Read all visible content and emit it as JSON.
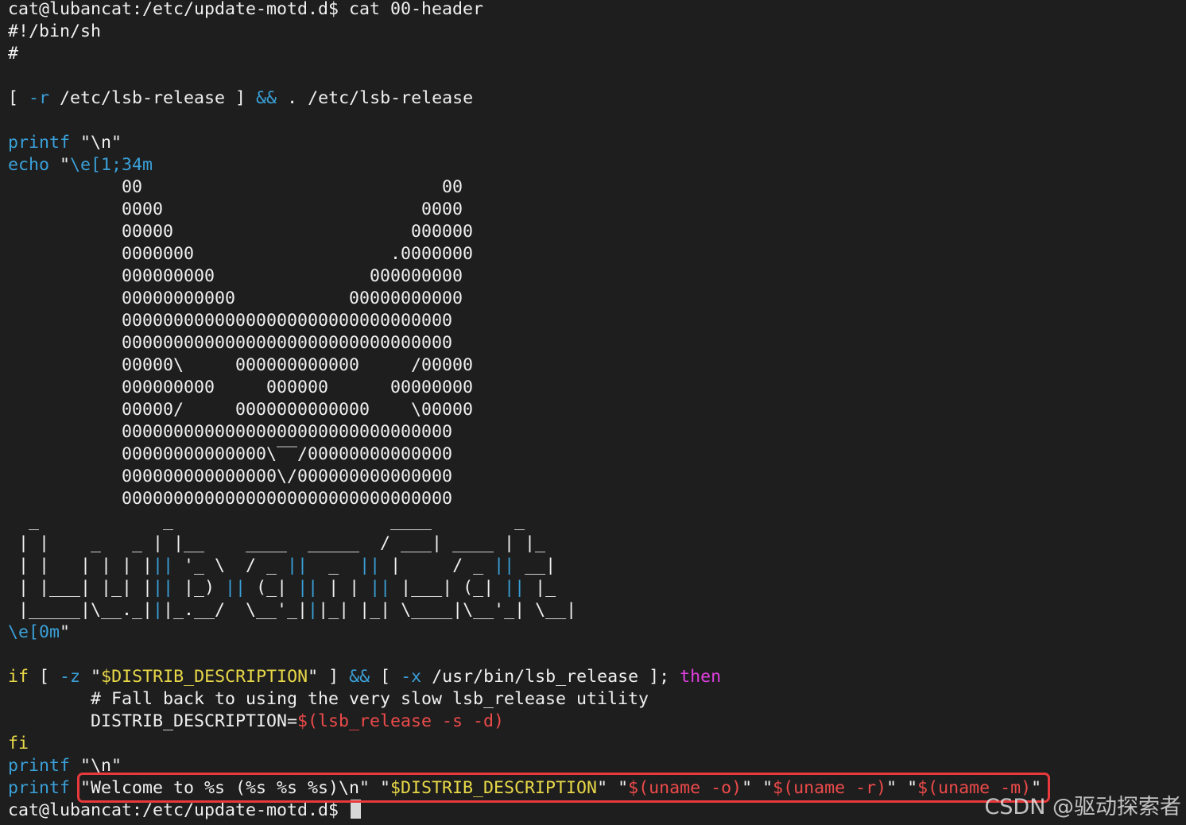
{
  "terminal": {
    "lines": [
      [
        {
          "t": "cat@lubancat:/etc/update-motd.d$ cat 00-header",
          "c": "white"
        }
      ],
      [
        {
          "t": "#!/bin/sh",
          "c": "white"
        }
      ],
      [
        {
          "t": "#",
          "c": "white"
        }
      ],
      [],
      [
        {
          "t": "[ ",
          "c": "white"
        },
        {
          "t": "-r",
          "c": "cyan"
        },
        {
          "t": " /etc/lsb-release ] ",
          "c": "white"
        },
        {
          "t": "&&",
          "c": "cyan"
        },
        {
          "t": " . /etc/lsb-release",
          "c": "white"
        }
      ],
      [],
      [
        {
          "t": "printf",
          "c": "cyan"
        },
        {
          "t": " \"\\n\"",
          "c": "white"
        }
      ],
      [
        {
          "t": "echo",
          "c": "cyan"
        },
        {
          "t": " \"",
          "c": "white"
        },
        {
          "t": "\\e[1;34m",
          "c": "cyan"
        }
      ],
      [
        {
          "t": "           00                             00",
          "c": "white"
        }
      ],
      [
        {
          "t": "           0000                         0000",
          "c": "white"
        }
      ],
      [
        {
          "t": "           00000                       000000",
          "c": "white"
        }
      ],
      [
        {
          "t": "           0000000                   .0000000",
          "c": "white"
        }
      ],
      [
        {
          "t": "           000000000               000000000",
          "c": "white"
        }
      ],
      [
        {
          "t": "           00000000000           00000000000",
          "c": "white"
        }
      ],
      [
        {
          "t": "           00000000000000000000000000000000",
          "c": "white"
        }
      ],
      [
        {
          "t": "           00000000000000000000000000000000",
          "c": "white"
        }
      ],
      [
        {
          "t": "           00000\\     000000000000     /00000",
          "c": "white"
        }
      ],
      [
        {
          "t": "           000000000     000000      00000000",
          "c": "white"
        }
      ],
      [
        {
          "t": "           00000/     0000000000000    \\00000",
          "c": "white"
        }
      ],
      [
        {
          "t": "           00000000000000000000000000000000",
          "c": "white"
        }
      ],
      [
        {
          "t": "           00000000000000\\‾‾/00000000000000",
          "c": "white"
        }
      ],
      [
        {
          "t": "           000000000000000\\/000000000000000",
          "c": "white"
        }
      ],
      [
        {
          "t": "           00000000000000000000000000000000",
          "c": "white"
        }
      ],
      [
        {
          "t": "  _            _                     ____        _",
          "c": "white"
        }
      ],
      [
        {
          "t": " | |    _   _ | |__    ____  _____  / ___| ____ | |_",
          "c": "white"
        }
      ],
      [
        {
          "t": " | |   | | | |",
          "c": "white"
        },
        {
          "t": "||",
          "c": "cyan"
        },
        {
          "t": " '_ \\  / _ ",
          "c": "white"
        },
        {
          "t": "||",
          "c": "cyan"
        },
        {
          "t": "  _  ",
          "c": "white"
        },
        {
          "t": "||",
          "c": "cyan"
        },
        {
          "t": " |     / _ ",
          "c": "white"
        },
        {
          "t": "||",
          "c": "cyan"
        },
        {
          "t": " __|",
          "c": "white"
        }
      ],
      [
        {
          "t": " | |___| |_| |",
          "c": "white"
        },
        {
          "t": "||",
          "c": "cyan"
        },
        {
          "t": " |_) ",
          "c": "white"
        },
        {
          "t": "||",
          "c": "cyan"
        },
        {
          "t": " (_| ",
          "c": "white"
        },
        {
          "t": "||",
          "c": "cyan"
        },
        {
          "t": " | | ",
          "c": "white"
        },
        {
          "t": "||",
          "c": "cyan"
        },
        {
          "t": " |___| (_| ",
          "c": "white"
        },
        {
          "t": "||",
          "c": "cyan"
        },
        {
          "t": " |_",
          "c": "white"
        }
      ],
      [
        {
          "t": " |_____|\\__._|",
          "c": "white"
        },
        {
          "t": "|",
          "c": "cyan"
        },
        {
          "t": "|_.__/  \\__'_|",
          "c": "white"
        },
        {
          "t": "|",
          "c": "cyan"
        },
        {
          "t": "|_| |_| \\____|\\__'_| \\__|",
          "c": "white"
        }
      ],
      [
        {
          "t": "\\e[0m",
          "c": "cyan"
        },
        {
          "t": "\"",
          "c": "white"
        }
      ],
      [],
      [
        {
          "t": "if",
          "c": "yellow"
        },
        {
          "t": " [ ",
          "c": "white"
        },
        {
          "t": "-z",
          "c": "cyan"
        },
        {
          "t": " \"",
          "c": "white"
        },
        {
          "t": "$DISTRIB_DESCRIPTION",
          "c": "yellow"
        },
        {
          "t": "\" ] ",
          "c": "white"
        },
        {
          "t": "&&",
          "c": "cyan"
        },
        {
          "t": " [ ",
          "c": "white"
        },
        {
          "t": "-x",
          "c": "cyan"
        },
        {
          "t": " /usr/bin/lsb_release ]; ",
          "c": "white"
        },
        {
          "t": "then",
          "c": "magenta"
        }
      ],
      [
        {
          "t": "        # Fall back to using the very slow lsb_release utility",
          "c": "white"
        }
      ],
      [
        {
          "t": "        DISTRIB_DESCRIPTION=",
          "c": "white"
        },
        {
          "t": "$(lsb_release -s -d)",
          "c": "red"
        }
      ],
      [
        {
          "t": "fi",
          "c": "yellow"
        }
      ],
      [
        {
          "t": "printf",
          "c": "cyan"
        },
        {
          "t": " \"\\n\"",
          "c": "white"
        }
      ],
      [
        {
          "t": "printf",
          "c": "cyan"
        },
        {
          "t": " \"Welcome to %s (%s %s %s)\\n\" \"",
          "c": "white"
        },
        {
          "t": "$DISTRIB_DESCRIPTION",
          "c": "yellow"
        },
        {
          "t": "\" \"",
          "c": "white"
        },
        {
          "t": "$(uname -o)",
          "c": "red"
        },
        {
          "t": "\" \"",
          "c": "white"
        },
        {
          "t": "$(uname -r)",
          "c": "red"
        },
        {
          "t": "\" \"",
          "c": "white"
        },
        {
          "t": "$(uname -m)",
          "c": "red"
        },
        {
          "t": "\"",
          "c": "white"
        }
      ]
    ],
    "prompt": "cat@lubancat:/etc/update-motd.d$ "
  },
  "colors": {
    "background": "#1e1e1e",
    "text": "#f0f0f0",
    "cyan": "#3aa0d8",
    "yellow": "#e8d848",
    "magenta": "#e040e0",
    "red": "#ee4a4a",
    "highlight_border": "#e8393c"
  },
  "watermark": "CSDN @驱动探索者"
}
